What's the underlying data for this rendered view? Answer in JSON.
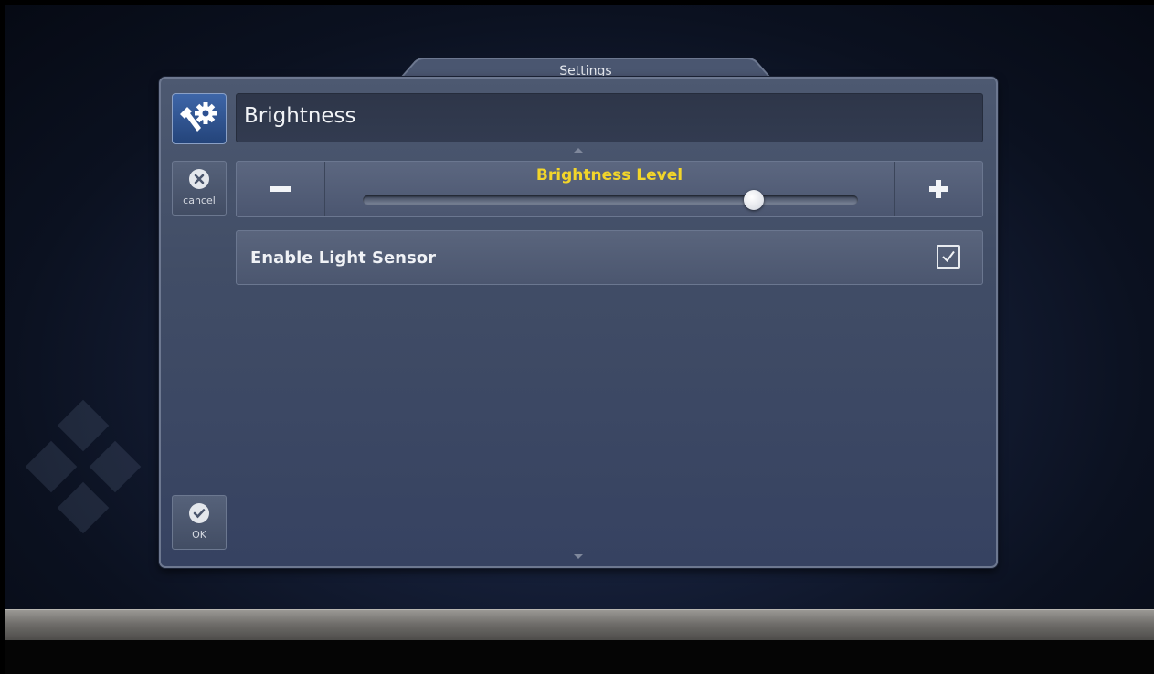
{
  "panel": {
    "title": "Settings",
    "header_title": "Brightness"
  },
  "sidebar": {
    "settings_icon": "wrench-gear-icon",
    "cancel": {
      "icon": "close-circle-icon",
      "label": "cancel"
    },
    "ok": {
      "icon": "check-circle-icon",
      "label": "OK"
    }
  },
  "brightness": {
    "label": "Brightness Level",
    "minus_icon": "minus-icon",
    "plus_icon": "plus-icon",
    "level_fraction": 0.79
  },
  "light_sensor": {
    "label": "Enable Light Sensor",
    "checked": true,
    "icon": "checkmark-icon"
  },
  "colors": {
    "accent_label": "#f2d52a",
    "icon_button": "#3e66a8",
    "panel_bg": "#414d66"
  }
}
